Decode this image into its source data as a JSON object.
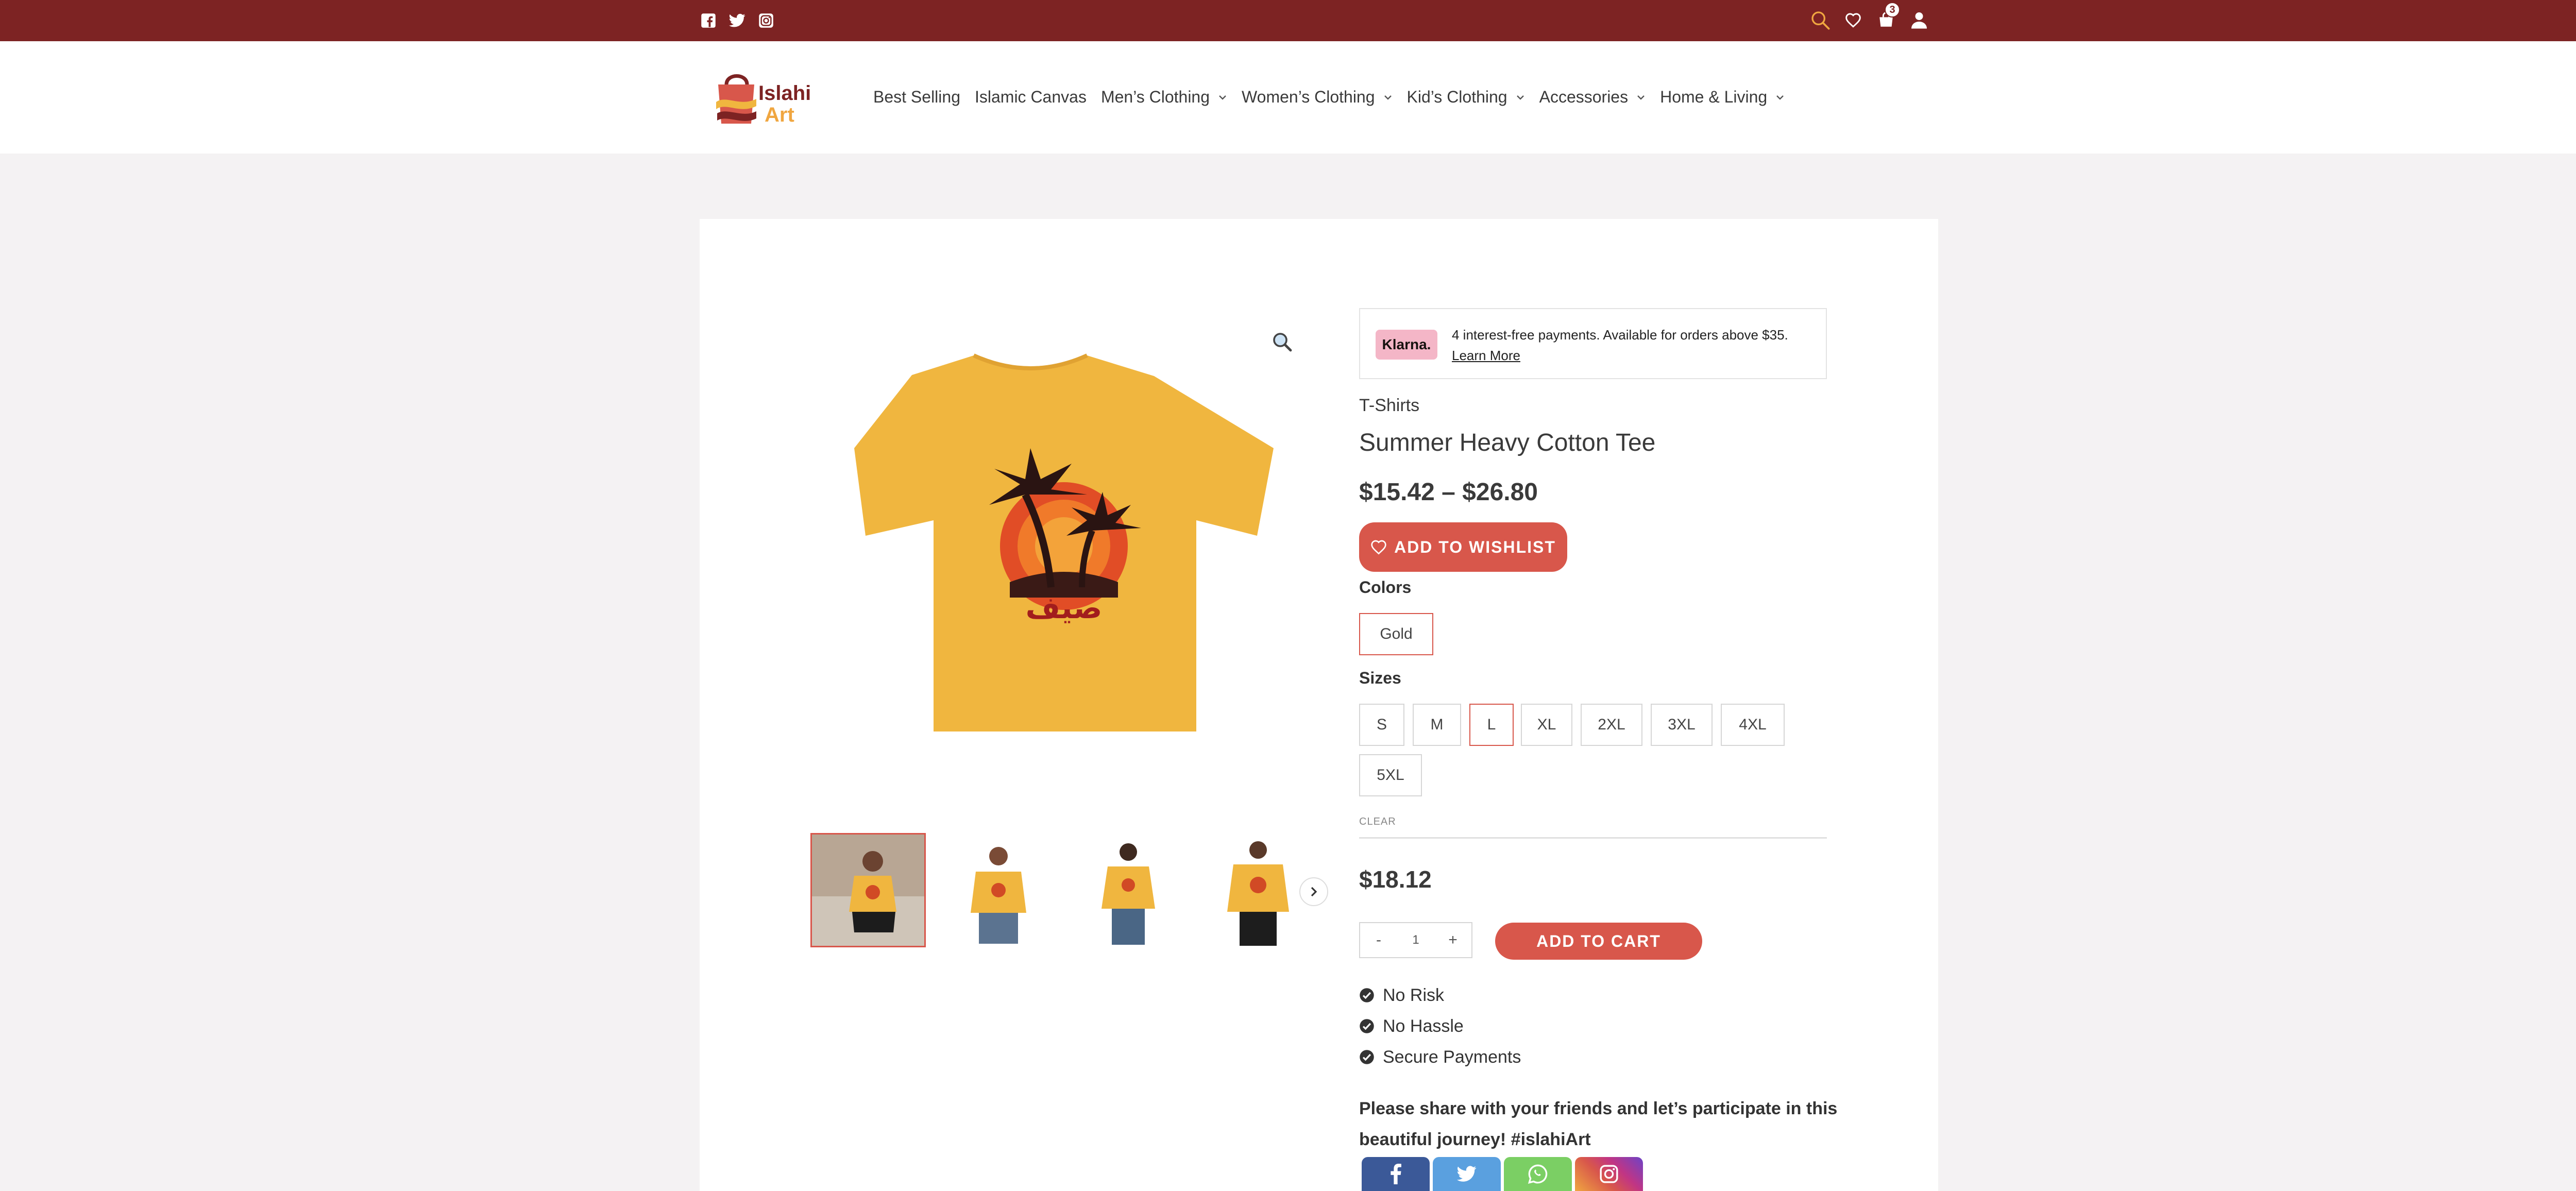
{
  "topbar": {
    "social": [
      "facebook-icon",
      "twitter-icon",
      "instagram-icon"
    ],
    "cart_count": "3"
  },
  "header": {
    "logo_alt": "Islahi Art",
    "nav": [
      {
        "label": "Best Selling",
        "has_dropdown": false
      },
      {
        "label": "Islamic Canvas",
        "has_dropdown": false
      },
      {
        "label": "Men’s Clothing",
        "has_dropdown": true
      },
      {
        "label": "Women’s Clothing",
        "has_dropdown": true
      },
      {
        "label": "Kid’s Clothing",
        "has_dropdown": true
      },
      {
        "label": "Accessories",
        "has_dropdown": true
      },
      {
        "label": "Home & Living",
        "has_dropdown": true
      }
    ]
  },
  "klarna": {
    "badge": "Klarna.",
    "text": "4 interest-free payments. Available for orders above $35.",
    "link": "Learn More"
  },
  "product": {
    "category": "T-Shirts",
    "title": "Summer Heavy Cotton Tee",
    "price_range": "$15.42 – $26.80",
    "wishlist_label": "ADD TO WISHLIST",
    "colors_label": "Colors",
    "colors": [
      "Gold"
    ],
    "selected_color": "Gold",
    "sizes_label": "Sizes",
    "sizes": [
      "S",
      "M",
      "L",
      "XL",
      "2XL",
      "3XL",
      "4XL",
      "5XL"
    ],
    "selected_size": "L",
    "clear_label": "CLEAR",
    "variation_price": "$18.12",
    "quantity": "1",
    "qty_minus": "-",
    "qty_plus": "+",
    "add_to_cart_label": "ADD TO CART",
    "features": [
      "No Risk",
      "No Hassle",
      "Secure Payments"
    ],
    "share_text": "Please share with your friends and let’s participate in this beautiful journey! #islahiArt"
  },
  "colors": {
    "topbar": "#7d2323",
    "accent": "#d8574b",
    "shirt": "#f0b63f",
    "facebook": "#3b5998",
    "twitter": "#5aa0df",
    "whatsapp": "#7bcf64",
    "instagram": "#c13584"
  },
  "share": [
    "facebook-icon",
    "twitter-icon",
    "whatsapp-icon",
    "instagram-icon"
  ]
}
